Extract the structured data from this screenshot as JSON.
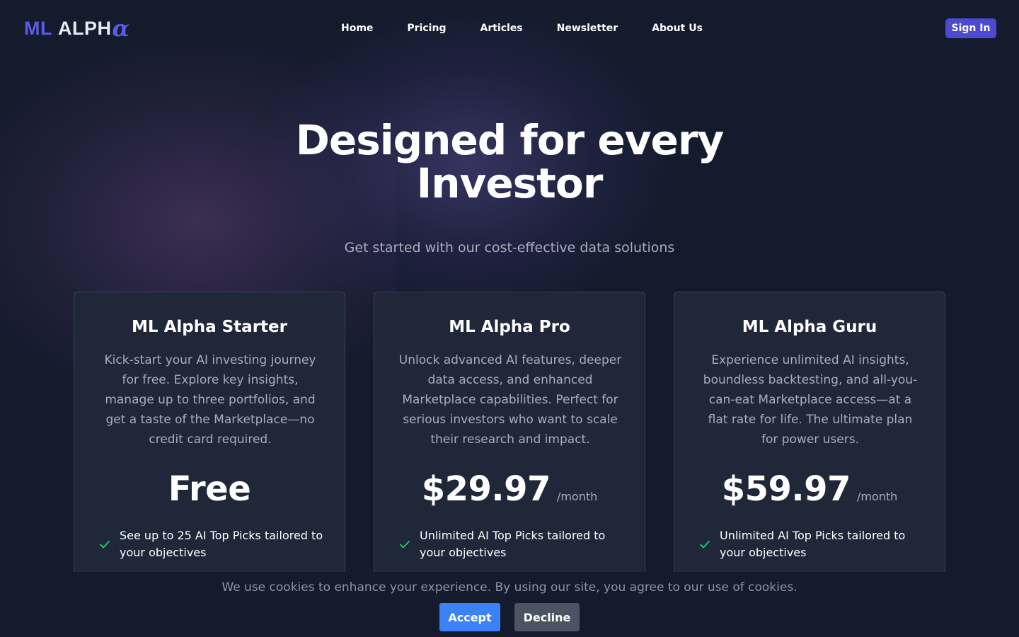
{
  "colors": {
    "background": "#141b2d",
    "accent": "#4a4bd0",
    "logo_accent": "#5b5be6",
    "card": "#1f2738",
    "check": "#22c55e",
    "accept": "#3b82f6",
    "decline": "#4b5462"
  },
  "header": {
    "logo": {
      "ml": "ML",
      "alph": "ALPH",
      "alpha": "α"
    },
    "nav": [
      "Home",
      "Pricing",
      "Articles",
      "Newsletter",
      "About Us"
    ],
    "signin_label": "Sign In"
  },
  "hero": {
    "title_line1": "Designed for every",
    "title_line2": "Investor",
    "subtitle": "Get started with our cost-effective data solutions"
  },
  "plans": [
    {
      "name": "ML Alpha Starter",
      "description": "Kick-start your AI investing journey for free. Explore key insights, manage up to three portfolios, and get a taste of the Marketplace—no credit card required.",
      "price": "Free",
      "period": "",
      "features": [
        "See up to 25 AI Top Picks tailored to your objectives"
      ]
    },
    {
      "name": "ML Alpha Pro",
      "description": "Unlock advanced AI features, deeper data access, and enhanced Marketplace capabilities. Perfect for serious investors who want to scale their research and impact.",
      "price": "$29.97",
      "period": "/month",
      "features": [
        "Unlimited AI Top Picks tailored to your objectives"
      ]
    },
    {
      "name": "ML Alpha Guru",
      "description": "Experience unlimited AI insights, boundless backtesting, and all-you-can-eat Marketplace access—at a flat rate for life. The ultimate plan for power users.",
      "price": "$59.97",
      "period": "/month",
      "features": [
        "Unlimited AI Top Picks tailored to your objectives"
      ]
    }
  ],
  "cookie": {
    "message": "We use cookies to enhance your experience. By using our site, you agree to our use of cookies.",
    "accept_label": "Accept",
    "decline_label": "Decline"
  },
  "icons": {
    "feature_check": "check-icon"
  }
}
